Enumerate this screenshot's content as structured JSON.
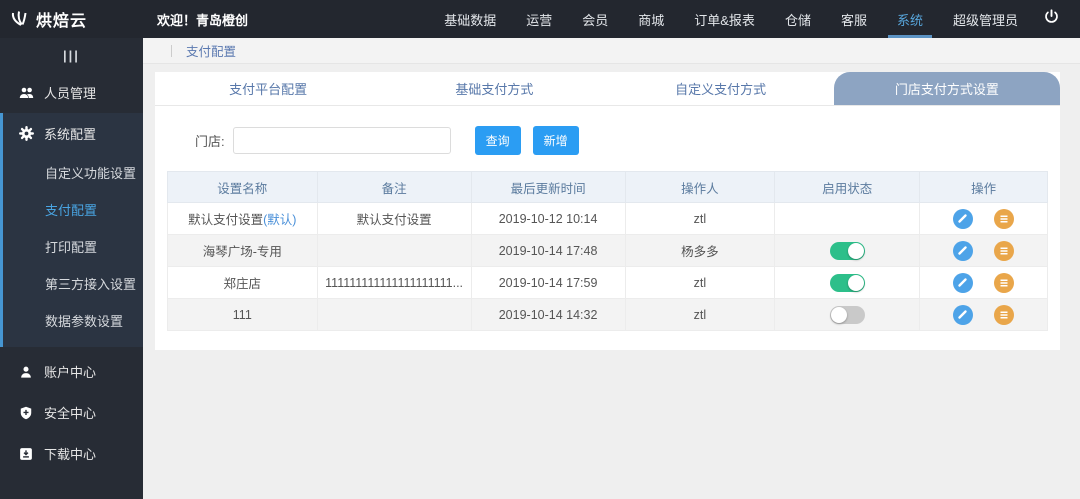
{
  "header": {
    "logo_text": "烘焙云",
    "welcome": "欢迎！青岛橙创",
    "nav_items": [
      {
        "label": "基础数据",
        "active": false
      },
      {
        "label": "运营",
        "active": false
      },
      {
        "label": "会员",
        "active": false
      },
      {
        "label": "商城",
        "active": false
      },
      {
        "label": "订单&报表",
        "active": false
      },
      {
        "label": "仓储",
        "active": false
      },
      {
        "label": "客服",
        "active": false
      },
      {
        "label": "系统",
        "active": true
      },
      {
        "label": "超级管理员",
        "active": false
      }
    ]
  },
  "sidebar": {
    "collapse_glyph": "|||",
    "item_users": {
      "label": "人员管理"
    },
    "item_system": {
      "label": "系统配置"
    },
    "system_children": [
      {
        "label": "自定义功能设置",
        "active": false
      },
      {
        "label": "支付配置",
        "active": true
      },
      {
        "label": "打印配置",
        "active": false
      },
      {
        "label": "第三方接入设置",
        "active": false
      },
      {
        "label": "数据参数设置",
        "active": false
      }
    ],
    "item_account": {
      "label": "账户中心"
    },
    "item_security": {
      "label": "安全中心"
    },
    "item_download": {
      "label": "下载中心"
    }
  },
  "breadcrumb": {
    "current": "支付配置"
  },
  "tabs": [
    {
      "label": "支付平台配置",
      "active": false
    },
    {
      "label": "基础支付方式",
      "active": false
    },
    {
      "label": "自定义支付方式",
      "active": false
    },
    {
      "label": "门店支付方式设置",
      "active": true
    }
  ],
  "filter": {
    "store_label": "门店:",
    "store_value": "",
    "query_button": "查询",
    "add_button": "新增"
  },
  "table": {
    "headers": [
      "设置名称",
      "备注",
      "最后更新时间",
      "操作人",
      "启用状态",
      "操作"
    ],
    "rows": [
      {
        "name": "默认支付设置",
        "name_badge": "(默认)",
        "remark": "默认支付设置",
        "updated": "2019-10-12 10:14",
        "operator": "ztl",
        "status": "none"
      },
      {
        "name": "海琴广场-专用",
        "name_badge": "",
        "remark": "",
        "updated": "2019-10-14 17:48",
        "operator": "杨多多",
        "status": "on"
      },
      {
        "name": "郑庄店",
        "name_badge": "",
        "remark": "111111111111111111111...",
        "updated": "2019-10-14 17:59",
        "operator": "ztl",
        "status": "on"
      },
      {
        "name": "111",
        "name_badge": "",
        "remark": "",
        "updated": "2019-10-14 14:32",
        "operator": "ztl",
        "status": "off"
      }
    ]
  },
  "colors": {
    "topbar_bg": "#23272f",
    "sidebar_bg": "#272c35",
    "accent_blue": "#2b9df3",
    "active_tab_bg": "#8da4c2",
    "toggle_on": "#2dbf8a",
    "toggle_off": "#c9c9c9",
    "edit_icon_bg": "#4da3e8",
    "list_icon_bg": "#e9a64a"
  }
}
